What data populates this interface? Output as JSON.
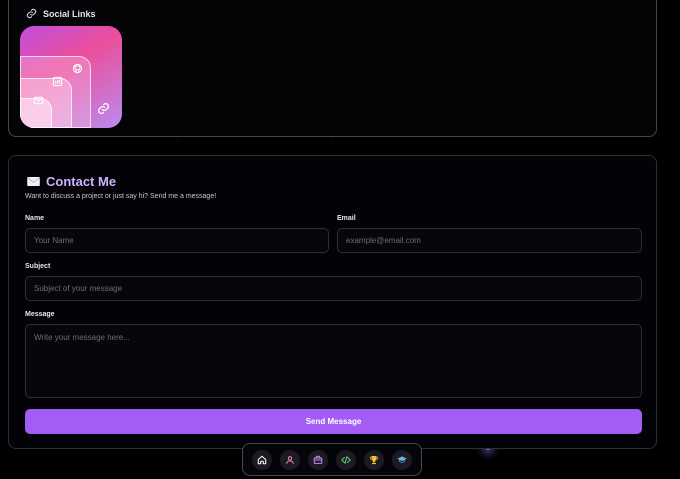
{
  "social": {
    "title": "Social Links",
    "icons": [
      "link-icon",
      "github-icon",
      "linkedin-icon",
      "mail-icon"
    ]
  },
  "contact": {
    "title": "Contact Me",
    "subtitle": "Want to discuss a project or just say hi? Send me a message!",
    "fields": {
      "name": {
        "label": "Name",
        "placeholder": "Your Name",
        "value": ""
      },
      "email": {
        "label": "Email",
        "placeholder": "example@email.com",
        "value": ""
      },
      "subject": {
        "label": "Subject",
        "placeholder": "Subject of your message",
        "value": ""
      },
      "message": {
        "label": "Message",
        "placeholder": "Write your message here...",
        "value": ""
      }
    },
    "submit_label": "Send Message"
  },
  "dock": {
    "items": [
      {
        "icon": "home-icon",
        "color": "#ffffff"
      },
      {
        "icon": "user-icon",
        "color": "#f07fb0"
      },
      {
        "icon": "briefcase-icon",
        "color": "#c58af5"
      },
      {
        "icon": "code-icon",
        "color": "#5ad07a"
      },
      {
        "icon": "trophy-icon",
        "color": "#f2c232"
      },
      {
        "icon": "graduation-cap-icon",
        "color": "#64b4f0"
      }
    ]
  },
  "colors": {
    "accent": "#a35cf4",
    "title": "#cdb3ff",
    "background": "#000000"
  }
}
